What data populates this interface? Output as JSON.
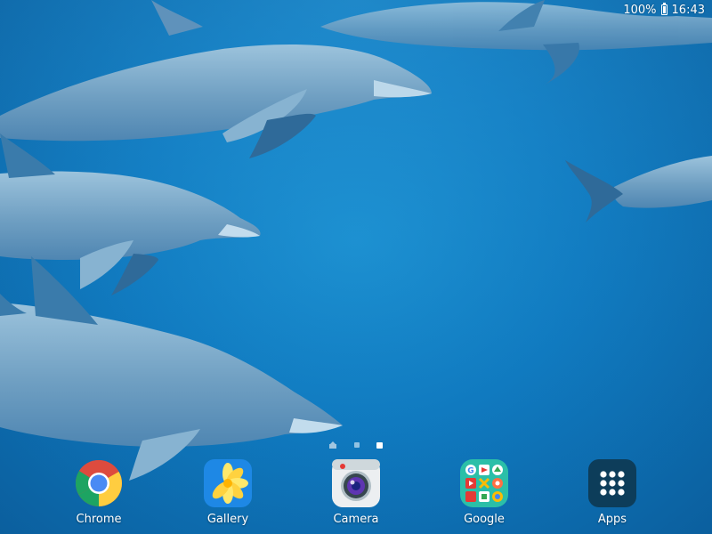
{
  "status_bar": {
    "battery_percent": "100%",
    "time": "16:43",
    "icons": [
      "battery-icon"
    ]
  },
  "home_screen": {
    "page_indicator": {
      "pages": 2,
      "active_page": 2,
      "has_home_marker": true
    }
  },
  "dock": {
    "apps": [
      {
        "label": "Chrome",
        "icon": "chrome-icon"
      },
      {
        "label": "Gallery",
        "icon": "gallery-icon"
      },
      {
        "label": "Camera",
        "icon": "camera-icon"
      },
      {
        "label": "Google",
        "icon": "google-folder-icon"
      },
      {
        "label": "Apps",
        "icon": "apps-grid-icon"
      }
    ]
  },
  "wallpaper": {
    "subject": "dolphins-underwater",
    "colors": {
      "water_light": "#1a8fd0",
      "water_dark": "#0b5f9e",
      "dolphin": "#7fa9c6"
    }
  }
}
